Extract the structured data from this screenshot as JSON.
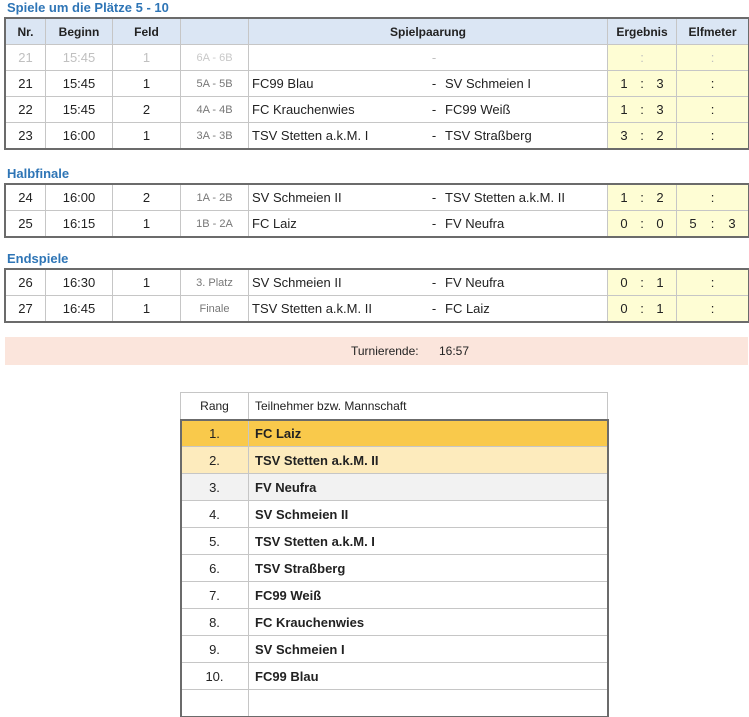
{
  "sections": {
    "placement_title": "Spiele um die Plätze  5 - 10",
    "semifinal_title": "Halbfinale",
    "finals_title": "Endspiele"
  },
  "headers": {
    "nr": "Nr.",
    "begin": "Beginn",
    "field": "Feld",
    "pairing": "Spielpaarung",
    "result": "Ergebnis",
    "penalty": "Elfmeter"
  },
  "placement_games": [
    {
      "nr": "21",
      "begin": "15:45",
      "field": "1",
      "pair": "6A - 6B",
      "home": "",
      "dash": "-",
      "away": "",
      "r1": "",
      "rsep": ":",
      "r2": "",
      "p1": "",
      "psep": ":",
      "p2": "",
      "muted": true
    },
    {
      "nr": "21",
      "begin": "15:45",
      "field": "1",
      "pair": "5A - 5B",
      "home": "FC99 Blau",
      "dash": "-",
      "away": "SV Schmeien I",
      "r1": "1",
      "rsep": ":",
      "r2": "3",
      "p1": "",
      "psep": ":",
      "p2": ""
    },
    {
      "nr": "22",
      "begin": "15:45",
      "field": "2",
      "pair": "4A - 4B",
      "home": "FC Krauchenwies",
      "dash": "-",
      "away": "FC99 Weiß",
      "r1": "1",
      "rsep": ":",
      "r2": "3",
      "p1": "",
      "psep": ":",
      "p2": ""
    },
    {
      "nr": "23",
      "begin": "16:00",
      "field": "1",
      "pair": "3A - 3B",
      "home": "TSV Stetten a.k.M. I",
      "dash": "-",
      "away": "TSV Straßberg",
      "r1": "3",
      "rsep": ":",
      "r2": "2",
      "p1": "",
      "psep": ":",
      "p2": ""
    }
  ],
  "semifinal_games": [
    {
      "nr": "24",
      "begin": "16:00",
      "field": "2",
      "pair": "1A - 2B",
      "home": "SV Schmeien II",
      "dash": "-",
      "away": "TSV Stetten a.k.M. II",
      "r1": "1",
      "rsep": ":",
      "r2": "2",
      "p1": "",
      "psep": ":",
      "p2": ""
    },
    {
      "nr": "25",
      "begin": "16:15",
      "field": "1",
      "pair": "1B - 2A",
      "home": "FC Laiz",
      "dash": "-",
      "away": "FV Neufra",
      "r1": "0",
      "rsep": ":",
      "r2": "0",
      "p1": "5",
      "psep": ":",
      "p2": "3"
    }
  ],
  "final_games": [
    {
      "nr": "26",
      "begin": "16:30",
      "field": "1",
      "pair": "3. Platz",
      "home": "SV Schmeien II",
      "dash": "-",
      "away": "FV Neufra",
      "r1": "0",
      "rsep": ":",
      "r2": "1",
      "p1": "",
      "psep": ":",
      "p2": ""
    },
    {
      "nr": "27",
      "begin": "16:45",
      "field": "1",
      "pair": "Finale",
      "home": "TSV Stetten a.k.M. II",
      "dash": "-",
      "away": "FC Laiz",
      "r1": "0",
      "rsep": ":",
      "r2": "1",
      "p1": "",
      "psep": ":",
      "p2": ""
    }
  ],
  "tournament_end": {
    "label": "Turnierende:",
    "time": "16:57"
  },
  "ranking": {
    "header_rank": "Rang",
    "header_team": "Teilnehmer bzw. Mannschaft",
    "rows": [
      {
        "rank": "1.",
        "team": "FC Laiz",
        "style": "gold"
      },
      {
        "rank": "2.",
        "team": "TSV Stetten a.k.M. II",
        "style": "lightgold"
      },
      {
        "rank": "3.",
        "team": "FV Neufra",
        "style": "silver"
      },
      {
        "rank": "4.",
        "team": "SV Schmeien II",
        "style": ""
      },
      {
        "rank": "5.",
        "team": "TSV Stetten a.k.M. I",
        "style": ""
      },
      {
        "rank": "6.",
        "team": "TSV Straßberg",
        "style": ""
      },
      {
        "rank": "7.",
        "team": "FC99 Weiß",
        "style": ""
      },
      {
        "rank": "8.",
        "team": "FC Krauchenwies",
        "style": ""
      },
      {
        "rank": "9.",
        "team": "SV Schmeien I",
        "style": ""
      },
      {
        "rank": "10.",
        "team": "FC99 Blau",
        "style": ""
      }
    ]
  },
  "colors": {
    "title_blue": "#2e75b6",
    "header_bg": "#dbe6f4",
    "result_bg": "#fefdd4",
    "end_bar_bg": "#fbe5dc",
    "gold": "#f9c94b",
    "light_gold": "#fdebbd"
  }
}
